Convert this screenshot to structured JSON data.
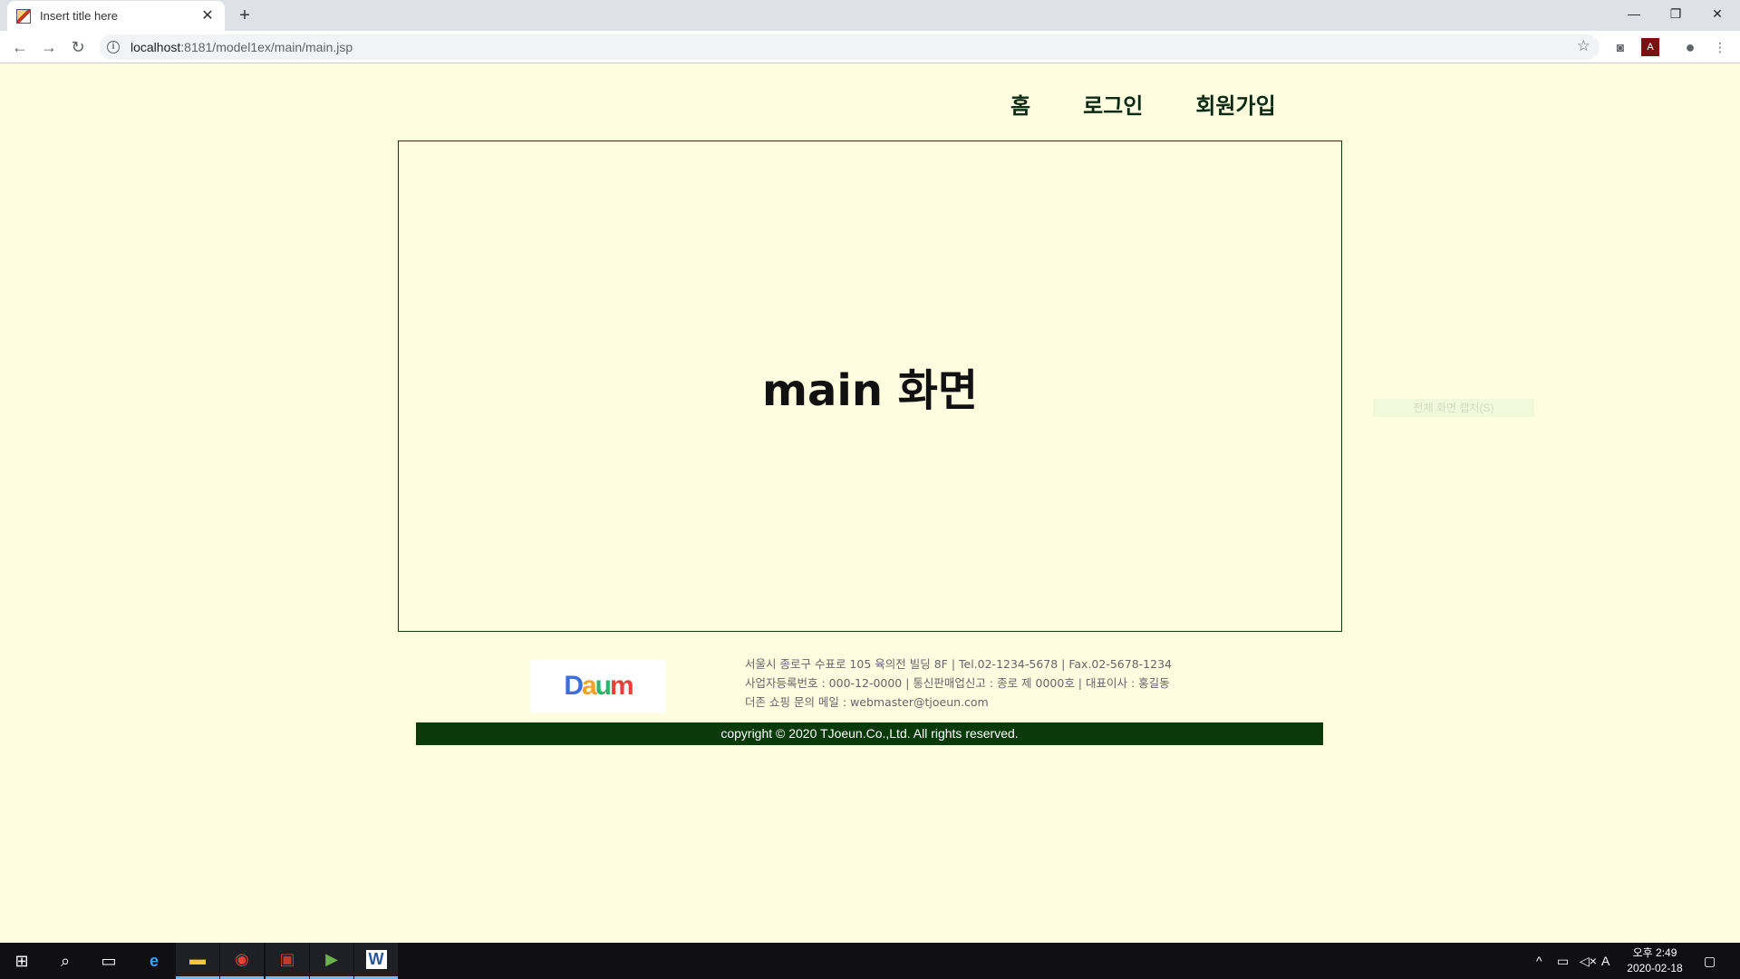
{
  "browser": {
    "tab_title": "Insert title here",
    "tab_close": "✕",
    "new_tab": "+",
    "url_host": "localhost",
    "url_path": ":8181/model1ex/main/main.jsp",
    "window_controls": {
      "minimize": "—",
      "restore": "❐",
      "close": "✕"
    }
  },
  "page": {
    "nav": [
      {
        "label": "홈"
      },
      {
        "label": "로그인"
      },
      {
        "label": "회원가입"
      }
    ],
    "main_title": "main 화면",
    "capture_hint": "전체 화면 캡처(S)",
    "footer": {
      "logo_text": "Daum",
      "line1": "서울시 종로구 수표로 105 육의전 빌딩 8F | Tel.02-1234-5678 | Fax.02-5678-1234",
      "line2": "사업자등록번호 : 000-12-0000 | 통신판매업신고 : 종로 제 0000호 | 대표이사 : 홍길동",
      "line3": "더존 쇼핑 문의 메일 : webmaster@tjoeun.com",
      "copyright": "copyright © 2020 TJoeun.Co.,Ltd. All rights reserved."
    }
  },
  "taskbar": {
    "clock_time": "오후 2:49",
    "clock_date": "2020-02-18",
    "ime": "A"
  },
  "colors": {
    "page_bg": "#fffde0",
    "accent_green": "#0a3a0a"
  }
}
